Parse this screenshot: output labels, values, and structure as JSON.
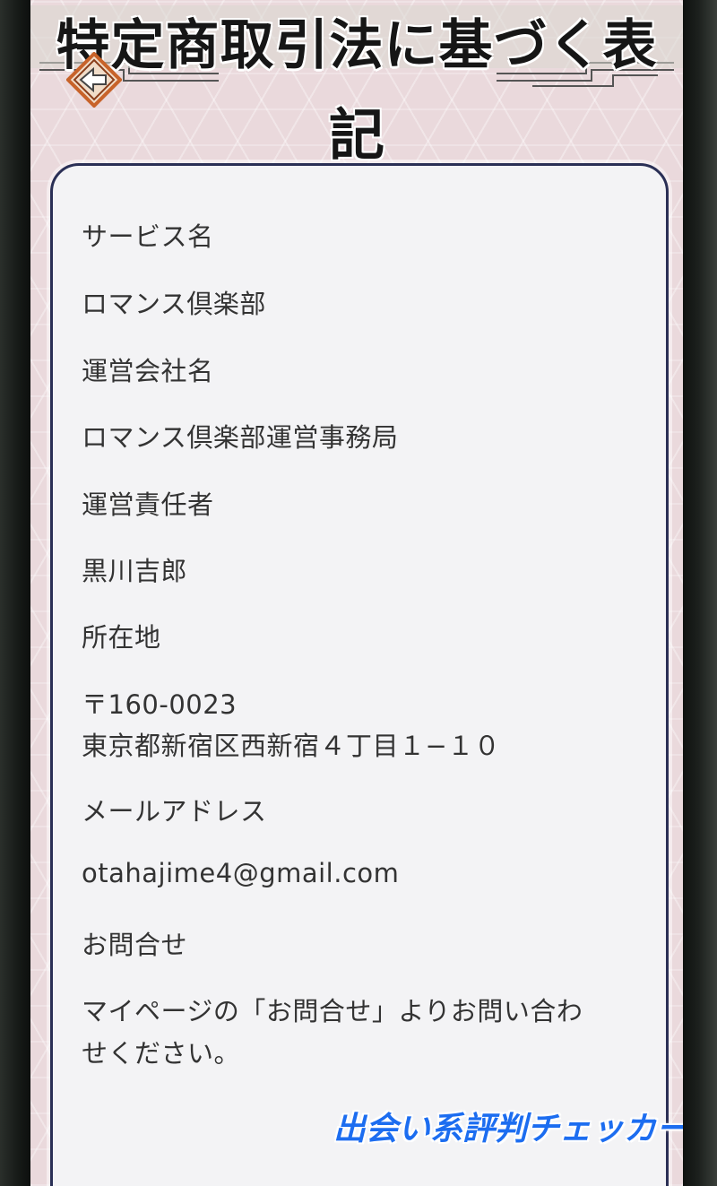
{
  "header": {
    "title_line1": "特定商取引法に基づく表",
    "title_line2": "記",
    "back_icon": "back-arrow-icon"
  },
  "details": [
    {
      "text": "サービス名"
    },
    {
      "text": "ロマンス倶楽部"
    },
    {
      "text": "運営会社名"
    },
    {
      "text": "ロマンス倶楽部運営事務局"
    },
    {
      "text": "運営責任者"
    },
    {
      "text": "黒川吉郎"
    },
    {
      "text": "所在地"
    },
    {
      "text": "〒160-0023"
    },
    {
      "text": "東京都新宿区西新宿４丁目１−１０"
    },
    {
      "text": "メールアドレス"
    },
    {
      "text": "otahajime4@gmail.com"
    },
    {
      "text": "お問合せ"
    },
    {
      "text": "マイページの「お問合せ」よりお問い合わ"
    },
    {
      "text": "せください。"
    }
  ],
  "watermark": "出会い系評判チェッカー",
  "colors": {
    "background": "#ead9dc",
    "card": "#f3f3f5",
    "card_border": "#2a2f55",
    "text": "#333333",
    "watermark": "#1c6df0",
    "back_button_accent": "#c8632a"
  }
}
